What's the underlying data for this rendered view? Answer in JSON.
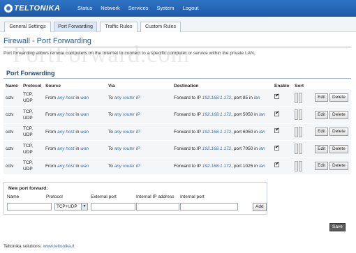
{
  "header": {
    "brand": "TELTONIKA",
    "nav": [
      "Status",
      "Network",
      "Services",
      "System",
      "Logout"
    ]
  },
  "tabs": [
    {
      "label": "General Settings",
      "active": false
    },
    {
      "label": "Port Forwarding",
      "active": true
    },
    {
      "label": "Traffic Rules",
      "active": false
    },
    {
      "label": "Custom Rules",
      "active": false
    }
  ],
  "page": {
    "title": "Firewall - Port Forwarding",
    "intro": "Port forwarding allows remote computers on the Internet to connect to a specific computer or service within the private LAN.",
    "watermark": "PortForward.com"
  },
  "forwards": {
    "section_title": "Port Forwarding",
    "columns": [
      "Name",
      "Protocol",
      "Source",
      "Via",
      "Destination",
      "Enable",
      "Sort"
    ],
    "rows": [
      {
        "name": "cctv",
        "protocol": "TCP, UDP",
        "src_prefix": "From",
        "src_host": "any host",
        "src_in": "in",
        "src_zone": "wan",
        "via_prefix": "To",
        "via": "any router IP",
        "dst_prefix": "Forward to IP",
        "dst_ip": "192.168.1.172",
        "dst_port_text": ", port 85 in",
        "dst_zone": "lan",
        "enabled": true
      },
      {
        "name": "cctv",
        "protocol": "TCP, UDP",
        "src_prefix": "From",
        "src_host": "any host",
        "src_in": "in",
        "src_zone": "wan",
        "via_prefix": "To",
        "via": "any router IP",
        "dst_prefix": "Forward to IP",
        "dst_ip": "192.168.1.172",
        "dst_port_text": ", port 5050 in",
        "dst_zone": "lan",
        "enabled": true
      },
      {
        "name": "cctv",
        "protocol": "TCP, UDP",
        "src_prefix": "From",
        "src_host": "any host",
        "src_in": "in",
        "src_zone": "wan",
        "via_prefix": "To",
        "via": "any router IP",
        "dst_prefix": "Forward to IP",
        "dst_ip": "192.168.1.172",
        "dst_port_text": ", port 6050 in",
        "dst_zone": "lan",
        "enabled": true
      },
      {
        "name": "cctv",
        "protocol": "TCP, UDP",
        "src_prefix": "From",
        "src_host": "any host",
        "src_in": "in",
        "src_zone": "wan",
        "via_prefix": "To",
        "via": "any router IP",
        "dst_prefix": "Forward to IP",
        "dst_ip": "192.168.1.172",
        "dst_port_text": ", port 7050 in",
        "dst_zone": "lan",
        "enabled": true
      },
      {
        "name": "cctv",
        "protocol": "TCP, UDP",
        "src_prefix": "From",
        "src_host": "any host",
        "src_in": "in",
        "src_zone": "wan",
        "via_prefix": "To",
        "via": "any router IP",
        "dst_prefix": "Forward to IP",
        "dst_ip": "192.168.1.172",
        "dst_port_text": ", port 1025 in",
        "dst_zone": "lan",
        "enabled": true
      }
    ],
    "edit_label": "Edit",
    "delete_label": "Delete"
  },
  "new_forward": {
    "title": "New port forward:",
    "columns": [
      "Name",
      "Protocol",
      "External port",
      "Internal IP address",
      "Internal port"
    ],
    "protocol_value": "TCP+UDP",
    "name_value": "",
    "external_port_value": "",
    "internal_ip_value": "",
    "internal_port_value": "",
    "add_label": "Add"
  },
  "save_label": "Save",
  "footer": {
    "prefix": "Teltonika solutions:",
    "link": "www.teltonika.lt"
  }
}
